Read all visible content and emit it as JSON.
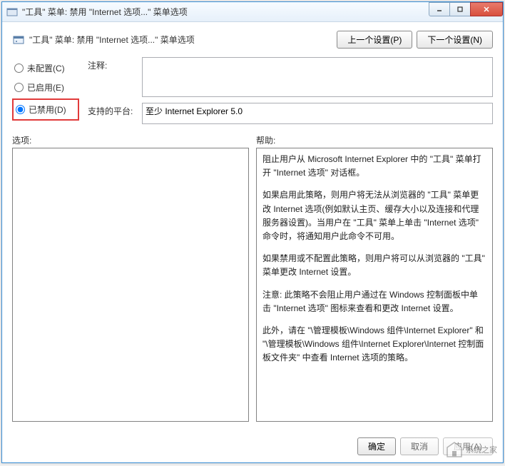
{
  "window": {
    "title": "\"工具\" 菜单: 禁用 \"Internet 选项...\" 菜单选项"
  },
  "header": {
    "title": "\"工具\" 菜单: 禁用 \"Internet 选项...\" 菜单选项",
    "prev_button": "上一个设置(P)",
    "next_button": "下一个设置(N)"
  },
  "radios": {
    "not_configured": "未配置(C)",
    "enabled": "已启用(E)",
    "disabled": "已禁用(D)",
    "selected": "disabled"
  },
  "fields": {
    "comment_label": "注释:",
    "comment_value": "",
    "platform_label": "支持的平台:",
    "platform_value": "至少 Internet Explorer 5.0"
  },
  "split": {
    "options_label": "选项:",
    "help_label": "帮助:"
  },
  "help": {
    "p1": "阻止用户从 Microsoft Internet Explorer 中的 \"工具\" 菜单打开 \"Internet 选项\" 对话框。",
    "p2": "如果启用此策略，则用户将无法从浏览器的 \"工具\" 菜单更改 Internet 选项(例如默认主页、缓存大小以及连接和代理服务器设置)。当用户在 \"工具\" 菜单上单击 \"Internet 选项\" 命令时，将通知用户此命令不可用。",
    "p3": "如果禁用或不配置此策略，则用户将可以从浏览器的 \"工具\" 菜单更改 Internet 设置。",
    "p4": "注意: 此策略不会阻止用户通过在 Windows 控制面板中单击 \"Internet 选项\" 图标来查看和更改 Internet 设置。",
    "p5": "此外，请在 \"\\管理模板\\Windows 组件\\Internet Explorer\" 和 \"\\管理模板\\Windows 组件\\Internet Explorer\\Internet 控制面板文件夹\" 中查看 Internet 选项的策略。"
  },
  "footer": {
    "ok": "确定",
    "cancel": "取消",
    "apply": "应用(A)"
  },
  "watermark": {
    "text": "系统之家"
  }
}
